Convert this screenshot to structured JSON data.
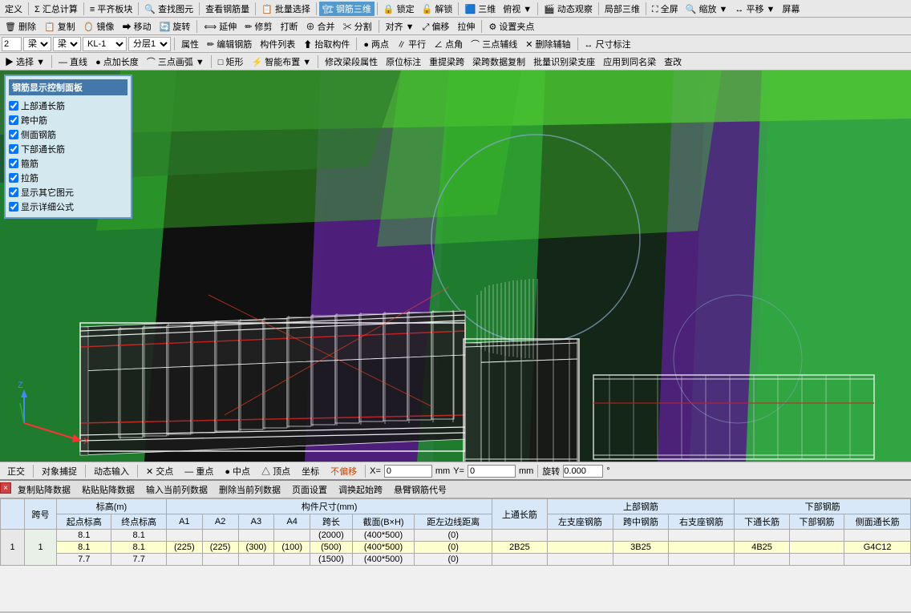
{
  "toolbar1": {
    "items": [
      "定义",
      "Σ 汇总计算",
      "≡ 平齐板块",
      "🔍 查找图元",
      "👁 查看钢筋量",
      "📋 批量选择",
      "🏗 钢筋三维",
      "🔒 锁定",
      "🔓 解锁",
      "🟦 三维",
      "👀 俯视",
      "🎬 动态观察",
      "⬡ 局部三维",
      "⛶ 全屏",
      "🔍 缩放▼",
      "↔ 平移▼",
      "🖥 屏幕"
    ]
  },
  "toolbar2": {
    "items": [
      "🗑 删除",
      "📋 复制",
      "🪞 镜像",
      "➡ 移动",
      "🔄 旋转",
      "⟺ 延伸",
      "✏ 修剪",
      "🖨 打断",
      "⊕ 合并",
      "✂ 分割",
      "⟺ 对齐▼",
      "⤢ 偏移",
      "⟵⟶ 拉伸",
      "⚙ 设置夹点"
    ]
  },
  "toolbar3": {
    "layer_num": "2",
    "type1": "梁",
    "type2": "梁",
    "name": "KL-1",
    "layer": "分层1",
    "items": [
      "属性",
      "编辑钢筋",
      "构件列表",
      "抬取构件",
      "两点",
      "平行",
      "点角",
      "三点辅线",
      "删除辅轴",
      "尺寸标注"
    ]
  },
  "toolbar4": {
    "items": [
      "选择▼",
      "直线",
      "点加长度",
      "三点画弧▼",
      "矩形",
      "智能布置▼",
      "修改梁段属性",
      "原位标注",
      "重提梁跨",
      "梁跨数据复制",
      "批量识别梁支座",
      "应用到同名梁",
      "查改"
    ]
  },
  "control_panel": {
    "title": "钢筋显示控制面板",
    "items": [
      {
        "label": "上部通长筋",
        "checked": true
      },
      {
        "label": "跨中筋",
        "checked": true
      },
      {
        "label": "侧面钢筋",
        "checked": true
      },
      {
        "label": "下部通长筋",
        "checked": true
      },
      {
        "label": "箍筋",
        "checked": true
      },
      {
        "label": "拉筋",
        "checked": true
      },
      {
        "label": "显示其它图元",
        "checked": true
      },
      {
        "label": "显示详细公式",
        "checked": true
      }
    ]
  },
  "status_bar": {
    "items": [
      "正交",
      "对象捕捉",
      "动态输入",
      "交点",
      "重点",
      "中点",
      "顶点",
      "坐标",
      "不偏移"
    ],
    "x_label": "X=",
    "x_value": "0",
    "mm1": "mm",
    "y_label": "Y=",
    "y_value": "0",
    "mm2": "mm",
    "rotate_label": "旋转",
    "rotate_value": "0.000"
  },
  "data_toolbar": {
    "items": [
      "复制贴降数据",
      "粘贴贴降数据",
      "输入当前列数据",
      "删除当前列数据",
      "页面设置",
      "调换起始跨",
      "悬臂钢筋代号"
    ]
  },
  "table": {
    "headers": {
      "span": "跨号",
      "elevation_group": "标高(m)",
      "elevation_start": "起点标高",
      "elevation_end": "终点标高",
      "component_group": "构件尺寸(mm)",
      "a1": "A1",
      "a2": "A2",
      "a3": "A3",
      "a4": "A4",
      "span_len": "跨长",
      "section": "截面(B×H)",
      "edge_dist": "距左边线距离",
      "top_through": "上通长筋",
      "top_rebar_group": "上部钢筋",
      "left_support": "左支座钢筋",
      "mid_rebar": "跨中钢筋",
      "right_support": "右支座钢筋",
      "bottom_group": "下部钢筋",
      "bottom_through": "下通长筋",
      "bottom_rebar": "下部钢筋",
      "side_through": "侧面通长筋"
    },
    "rows": [
      {
        "row_num": "1",
        "span_num": "1",
        "sub_rows": [
          {
            "elev_start": "8.1",
            "elev_end": "8.1",
            "a1": "",
            "a2": "",
            "a3": "",
            "a4": "",
            "span_len": "(2000)",
            "section": "(400*500)",
            "edge_dist": "(0)",
            "top_through": "",
            "left_support": "",
            "mid_rebar": "",
            "right_support": "",
            "bottom_through": "",
            "bottom_rebar": "",
            "side_through": ""
          },
          {
            "elev_start": "8.1",
            "elev_end": "8.1",
            "a1": "(225)",
            "a2": "(225)",
            "a3": "(300)",
            "a4": "(100)",
            "span_len": "(500)",
            "section": "(400*500)",
            "edge_dist": "(0)",
            "top_through": "2B25",
            "left_support": "",
            "mid_rebar": "3B25",
            "right_support": "",
            "bottom_through": "4B25",
            "bottom_rebar": "",
            "side_through": "G4C12"
          },
          {
            "elev_start": "7.7",
            "elev_end": "7.7",
            "a1": "",
            "a2": "",
            "a3": "",
            "a4": "",
            "span_len": "(1500)",
            "section": "(400*500)",
            "edge_dist": "(0)",
            "top_through": "",
            "left_support": "",
            "mid_rebar": "",
            "right_support": "",
            "bottom_through": "",
            "bottom_rebar": "",
            "side_through": ""
          }
        ]
      }
    ]
  }
}
